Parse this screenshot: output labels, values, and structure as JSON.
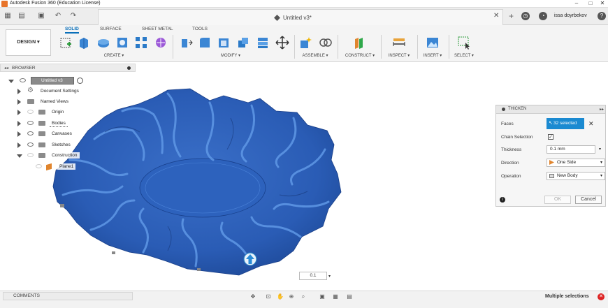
{
  "window": {
    "title": "Autodesk Fusion 360 (Education License)"
  },
  "tabbar": {
    "doc_title": "Untitled v3*",
    "user": "issa doyrbekov"
  },
  "ribbon": {
    "workspace": "DESIGN ▾",
    "tabs": [
      "SOLID",
      "SURFACE",
      "SHEET METAL",
      "TOOLS"
    ],
    "groups": [
      "CREATE ▾",
      "MODIFY ▾",
      "ASSEMBLE ▾",
      "CONSTRUCT ▾",
      "INSPECT ▾",
      "INSERT ▾",
      "SELECT ▾"
    ]
  },
  "browser": {
    "title": "BROWSER",
    "items": [
      {
        "label": "Untitled v3"
      },
      {
        "label": "Document Settings"
      },
      {
        "label": "Named Views"
      },
      {
        "label": "Origin"
      },
      {
        "label": "Bodies"
      },
      {
        "label": "Canvases"
      },
      {
        "label": "Sketches"
      },
      {
        "label": "Construction"
      },
      {
        "label": "Plane1"
      }
    ]
  },
  "thicken": {
    "title": "THICKEN",
    "faces_label": "Faces",
    "faces_value": "32 selected",
    "chain_label": "Chain Selection",
    "thickness_label": "Thickness",
    "thickness_value": "0.1 mm",
    "direction_label": "Direction",
    "direction_value": "One Side",
    "operation_label": "Operation",
    "operation_value": "New Body",
    "ok": "OK",
    "cancel": "Cancel"
  },
  "viewport": {
    "thickness_input": "0.1"
  },
  "bottombar": {
    "comments": "COMMENTS",
    "status": "Multiple selections"
  },
  "colors": {
    "accent": "#1b8ad1",
    "body": "#2b5fb8"
  }
}
